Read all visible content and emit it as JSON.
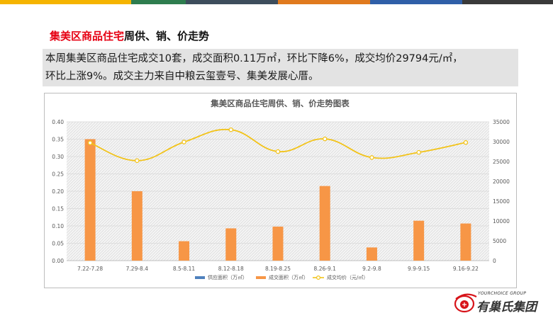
{
  "header": {
    "title_red": "集美区商品住宅",
    "title_black": "周供、销、价走势"
  },
  "summary": {
    "line1": "本周集美区商品住宅成交10套，成交面积0.11万㎡，环比下降6%，成交均价29794元/㎡，",
    "line2": "环比上涨9%。成交主力来自中粮云玺壹号、集美发展心厝。"
  },
  "logo": {
    "en": "YOURCHOICE GROUP",
    "cn": "有巢氏集团",
    "mark_icon": "yourchoice-logo-icon"
  },
  "colors": {
    "topbar": [
      "#f5b400",
      "#2e7d4f",
      "#3d4d5c",
      "#e07a1e",
      "#2f5fa8",
      "#3a3a3a"
    ],
    "supply": "#4f81bd",
    "deal_area": "#f79646",
    "avg_price": "#f2c31a",
    "title_red": "#e60012"
  },
  "chart_data": {
    "type": "bar",
    "title": "集美区商品住宅周供、销、价走势图表",
    "categories": [
      "7.22-7.28",
      "7.29-8.4",
      "8.5-8.11",
      "8.12-8.18",
      "8.19-8.25",
      "8.26-9.1",
      "9.2-9.8",
      "9.9-9.15",
      "9.16-9.22"
    ],
    "series": [
      {
        "name": "供应面积（万㎡）",
        "type": "bar",
        "axis": "left",
        "values": [
          0,
          0,
          0,
          0,
          0,
          0,
          0,
          0,
          0
        ]
      },
      {
        "name": "成交面积（万㎡）",
        "type": "bar",
        "axis": "left",
        "values": [
          0.35,
          0.2,
          0.056,
          0.093,
          0.098,
          0.215,
          0.038,
          0.115,
          0.107
        ]
      },
      {
        "name": "成交均价（元/㎡）",
        "type": "line",
        "axis": "right",
        "values": [
          29700,
          25200,
          29900,
          33000,
          27500,
          30700,
          26000,
          27300,
          29794
        ]
      }
    ],
    "ylim_left": [
      0,
      0.4
    ],
    "yticks_left": [
      "0.00",
      "0.05",
      "0.10",
      "0.15",
      "0.20",
      "0.25",
      "0.30",
      "0.35",
      "0.40"
    ],
    "ylim_right": [
      0,
      35000
    ],
    "yticks_right": [
      "0",
      "5000",
      "10000",
      "15000",
      "20000",
      "25000",
      "30000",
      "35000"
    ],
    "legend_position": "bottom",
    "grid": true
  }
}
